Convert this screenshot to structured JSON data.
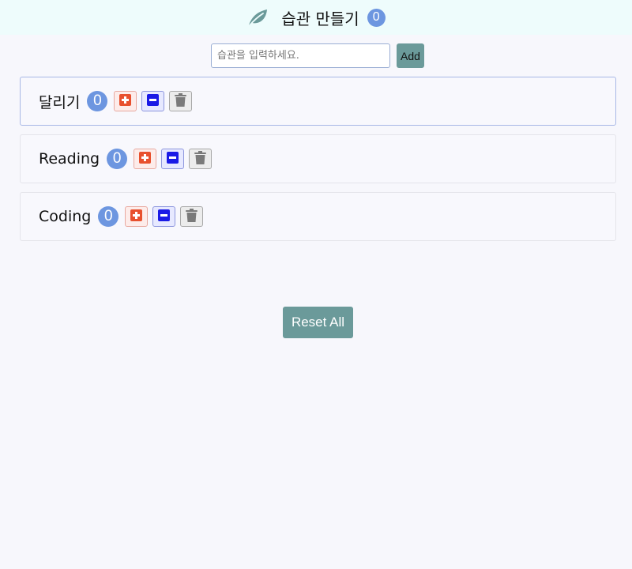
{
  "navbar": {
    "logo_icon": "leaf-icon",
    "title": "습관 만들기",
    "active_count": "0"
  },
  "add_form": {
    "placeholder": "습관을 입력하세요.",
    "value": "",
    "add_label": "Add"
  },
  "habits": [
    {
      "name": "달리기",
      "count": "0",
      "increase_icon": "plus-square-icon",
      "decrease_icon": "minus-square-icon",
      "delete_icon": "trash-icon"
    },
    {
      "name": "Reading",
      "count": "0",
      "increase_icon": "plus-square-icon",
      "decrease_icon": "minus-square-icon",
      "delete_icon": "trash-icon"
    },
    {
      "name": "Coding",
      "count": "0",
      "increase_icon": "plus-square-icon",
      "decrease_icon": "minus-square-icon",
      "delete_icon": "trash-icon"
    }
  ],
  "reset_label": "Reset All",
  "colors": {
    "navbar_bg": "#eefcfc",
    "page_bg": "#f7f7fc",
    "badge": "#6d96e0",
    "accent": "#6b9a9a",
    "increase": "#e8502e",
    "decrease": "#1a1ae6",
    "delete": "#7a7a7a"
  }
}
